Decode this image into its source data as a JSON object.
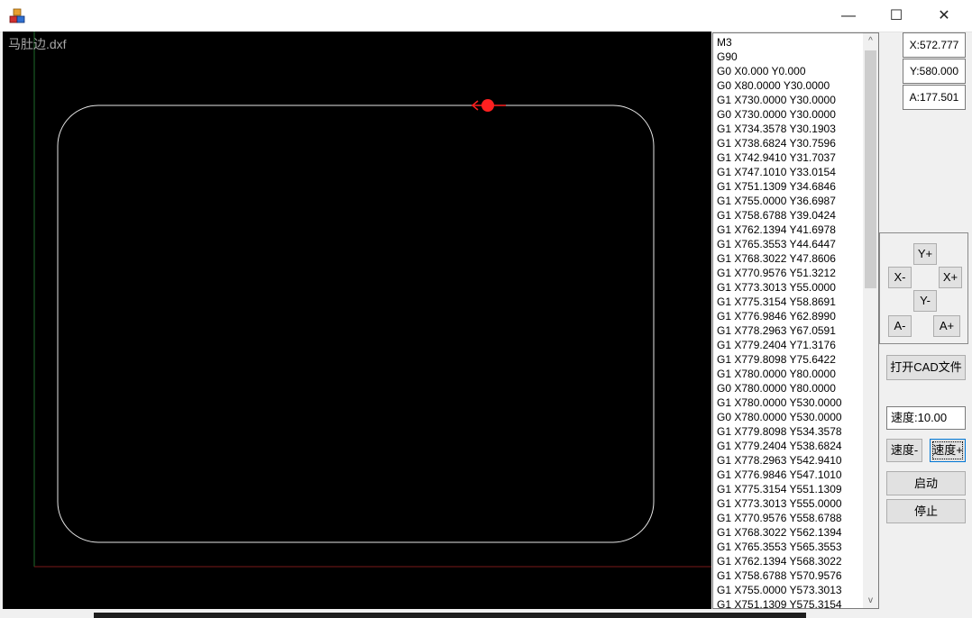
{
  "window": {
    "minimize_glyph": "—",
    "maximize_glyph": "☐",
    "close_glyph": "✕",
    "icon": "app-cubes-icon"
  },
  "canvas": {
    "filename": "马肚边.dxf",
    "background": "#000000",
    "path_color": "#ffffff",
    "marker_color": "#ff2020"
  },
  "gcode": {
    "lines": [
      "M3",
      "G90",
      "G0 X0.000 Y0.000",
      "G0 X80.0000 Y30.0000",
      "G1 X730.0000 Y30.0000",
      "G0 X730.0000 Y30.0000",
      "G1 X734.3578 Y30.1903",
      "G1 X738.6824 Y30.7596",
      "G1 X742.9410 Y31.7037",
      "G1 X747.1010 Y33.0154",
      "G1 X751.1309 Y34.6846",
      "G1 X755.0000 Y36.6987",
      "G1 X758.6788 Y39.0424",
      "G1 X762.1394 Y41.6978",
      "G1 X765.3553 Y44.6447",
      "G1 X768.3022 Y47.8606",
      "G1 X770.9576 Y51.3212",
      "G1 X773.3013 Y55.0000",
      "G1 X775.3154 Y58.8691",
      "G1 X776.9846 Y62.8990",
      "G1 X778.2963 Y67.0591",
      "G1 X779.2404 Y71.3176",
      "G1 X779.8098 Y75.6422",
      "G1 X780.0000 Y80.0000",
      "G0 X780.0000 Y80.0000",
      "G1 X780.0000 Y530.0000",
      "G0 X780.0000 Y530.0000",
      "G1 X779.8098 Y534.3578",
      "G1 X779.2404 Y538.6824",
      "G1 X778.2963 Y542.9410",
      "G1 X776.9846 Y547.1010",
      "G1 X775.3154 Y551.1309",
      "G1 X773.3013 Y555.0000",
      "G1 X770.9576 Y558.6788",
      "G1 X768.3022 Y562.1394",
      "G1 X765.3553 Y565.3553",
      "G1 X762.1394 Y568.3022",
      "G1 X758.6788 Y570.9576",
      "G1 X755.0000 Y573.3013",
      "G1 X751.1309 Y575.3154"
    ],
    "scroll_up": "^",
    "scroll_down": "v"
  },
  "readouts": {
    "x": "X:572.777",
    "y": "Y:580.000",
    "a": "A:177.501"
  },
  "jog": {
    "y_plus": "Y+",
    "x_minus": "X-",
    "x_plus": "X+",
    "y_minus": "Y-",
    "a_minus": "A-",
    "a_plus": "A+"
  },
  "controls": {
    "open_cad": "打开CAD文件",
    "speed_value": "速度:10.00",
    "speed_minus": "速度-",
    "speed_plus": "速度+",
    "start": "启动",
    "stop": "停止"
  }
}
